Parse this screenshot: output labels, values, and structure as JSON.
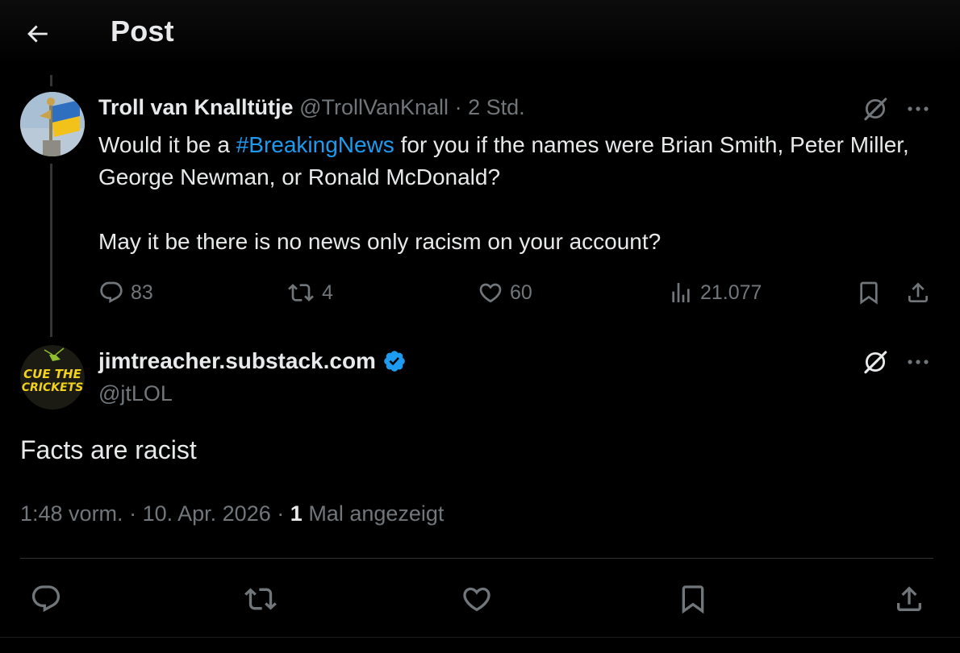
{
  "header": {
    "title": "Post",
    "back_icon": "arrow-left-icon"
  },
  "parent_tweet": {
    "display_name": "Troll van Knalltütje",
    "handle": "@TrollVanKnall",
    "separator": "·",
    "time": "2 Std.",
    "text_before_hashtag": "Would it be a ",
    "hashtag": "#BreakingNews",
    "text_after_hashtag": " for you if the names were Brian Smith, Peter Miller, George Newman, or Ronald McDonald?",
    "text_paragraph_2": "May it be there is no news only racism on your account?",
    "stats": {
      "replies": "83",
      "reposts": "4",
      "likes": "60",
      "views": "21.077"
    },
    "avatar_desc": "ukrainian-flag-statue-avatar"
  },
  "main_tweet": {
    "display_name": "jimtreacher.substack.com",
    "verified": true,
    "handle": "@jtLOL",
    "avatar_text_line1": "CUE THE",
    "avatar_text_line2": "CRICKETS",
    "text": "Facts are racist",
    "timestamp": "1:48 vorm.",
    "date": "10. Apr. 2026",
    "separator": "·",
    "views_count": "1",
    "views_label": "Mal angezeigt"
  },
  "colors": {
    "background": "#000000",
    "text_primary": "#e7e9ea",
    "text_secondary": "#71767b",
    "accent": "#1d9bf0",
    "divider": "#2f3336"
  }
}
